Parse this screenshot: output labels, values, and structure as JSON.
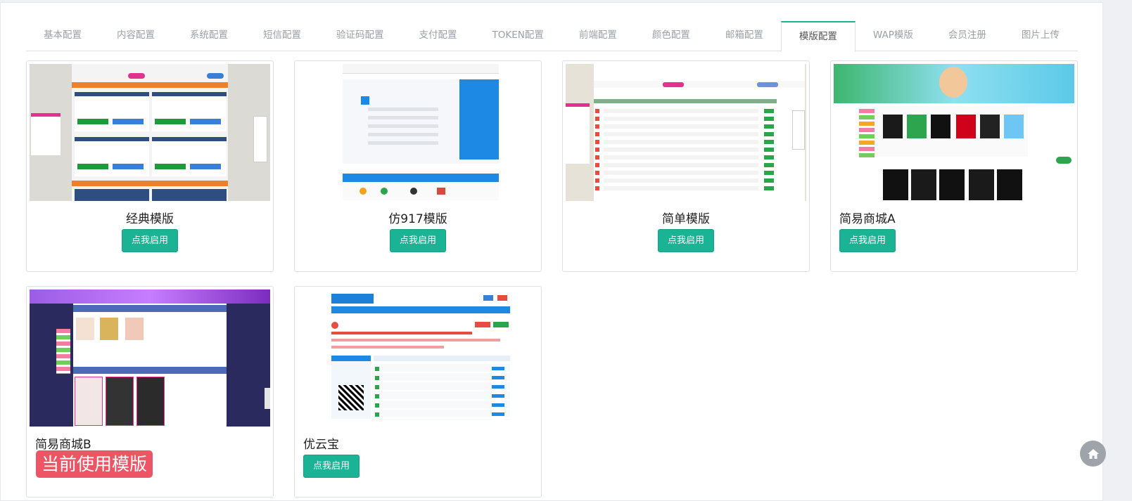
{
  "tabs": [
    {
      "label": "基本配置",
      "active": false
    },
    {
      "label": "内容配置",
      "active": false
    },
    {
      "label": "系统配置",
      "active": false
    },
    {
      "label": "短信配置",
      "active": false
    },
    {
      "label": "验证码配置",
      "active": false
    },
    {
      "label": "支付配置",
      "active": false
    },
    {
      "label": "TOKEN配置",
      "active": false
    },
    {
      "label": "前端配置",
      "active": false
    },
    {
      "label": "颜色配置",
      "active": false
    },
    {
      "label": "邮箱配置",
      "active": false
    },
    {
      "label": "模版配置",
      "active": true
    },
    {
      "label": "WAP模版",
      "active": false
    },
    {
      "label": "会员注册",
      "active": false
    },
    {
      "label": "图片上传",
      "active": false
    }
  ],
  "templates": [
    {
      "name": "经典模版",
      "action": "点我启用"
    },
    {
      "name": "仿917模版",
      "action": "点我启用"
    },
    {
      "name": "简单模版",
      "action": "点我启用"
    },
    {
      "name": "简易商城A",
      "action": "点我启用"
    },
    {
      "name": "简易商城B",
      "status": "当前使用模版"
    },
    {
      "name": "优云宝",
      "action": "点我启用"
    }
  ],
  "colors": {
    "accent": "#1ab394",
    "danger": "#ed5565"
  },
  "icons": {
    "home": "home-icon"
  }
}
